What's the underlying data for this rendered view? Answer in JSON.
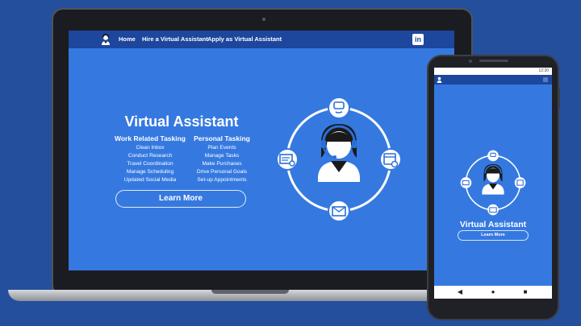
{
  "nav": {
    "links": [
      "Home",
      "Hire a Virtual Assistant",
      "Apply as Virtual Assistant"
    ],
    "linkedin_label": "in"
  },
  "hero": {
    "title": "Virtual Assistant",
    "work": {
      "heading": "Work Related Tasking",
      "items": [
        "Clean Inbox",
        "Conduct Research",
        "Travel Coordination",
        "Manage Scheduling",
        "Updated Social Media"
      ]
    },
    "personal": {
      "heading": "Personal Tasking",
      "items": [
        "Plan Events",
        "Manage Tasks",
        "Make Purchases",
        "Drive Personal Goals",
        "Set-up Appointments"
      ]
    },
    "cta": "Learn More"
  },
  "mobile": {
    "status_time": "12:30",
    "title": "Virtual Assistant",
    "cta": "Learn More"
  },
  "icons": [
    "phone-chat-icon",
    "calendar-clock-icon",
    "envelope-icon",
    "document-search-icon",
    "headset-agent-icon",
    "linkedin-icon",
    "assistant-logo-icon"
  ],
  "colors": {
    "background": "#234f9c",
    "screen": "#3579e0",
    "nav": "#1d469d",
    "text": "#ffffff"
  }
}
